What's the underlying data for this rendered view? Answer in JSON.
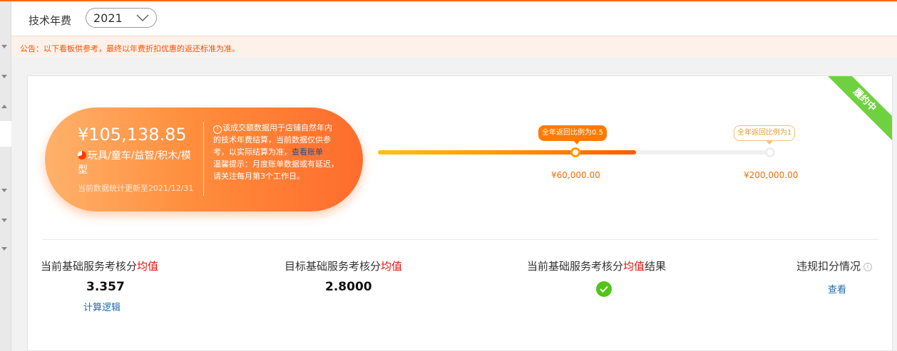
{
  "header": {
    "title": "技术年费",
    "year": "2021"
  },
  "notice": {
    "prefix": "公告：以下看板供参考，最终以",
    "link": "年费折扣优惠的返还标准",
    "suffix": "为准。"
  },
  "status_ribbon": "履约中",
  "summary": {
    "amount": "¥105,138.85",
    "category": "玩具/童车/益智/积木/模型",
    "update_note": "当前数据统计更新至2021/12/31",
    "info_text": "该成交额数据用于店铺自然年内的技术年费结算，当前数据仅供参考，以实际结算为准，",
    "info_link": "查看账单",
    "tip_text": "温馨提示：月度账单数据或有延迟，请关注每月第3个工作日。"
  },
  "progress": {
    "milestones": [
      {
        "tooltip": "全年返回比例为0.5",
        "amount": "¥60,000.00"
      },
      {
        "tooltip": "全年返回比例为1",
        "amount": "¥200,000.00"
      }
    ],
    "colors": {
      "fill_start": "#ffc20e",
      "fill_end": "#ff5a00",
      "track": "#f0f0f0"
    }
  },
  "metrics": [
    {
      "label": "当前基础服务考核分",
      "highlight": "均值",
      "value": "3.357",
      "link": "计算逻辑"
    },
    {
      "label": "目标基础服务考核分",
      "highlight": "均值",
      "value": "2.8000"
    },
    {
      "label": "当前基础服务考核分",
      "highlight": "均值",
      "suffix": "结果",
      "result_icon": "check-circle-icon"
    },
    {
      "label": "违规扣分情况",
      "info_icon": "question-circle-icon",
      "link": "查看"
    }
  ]
}
